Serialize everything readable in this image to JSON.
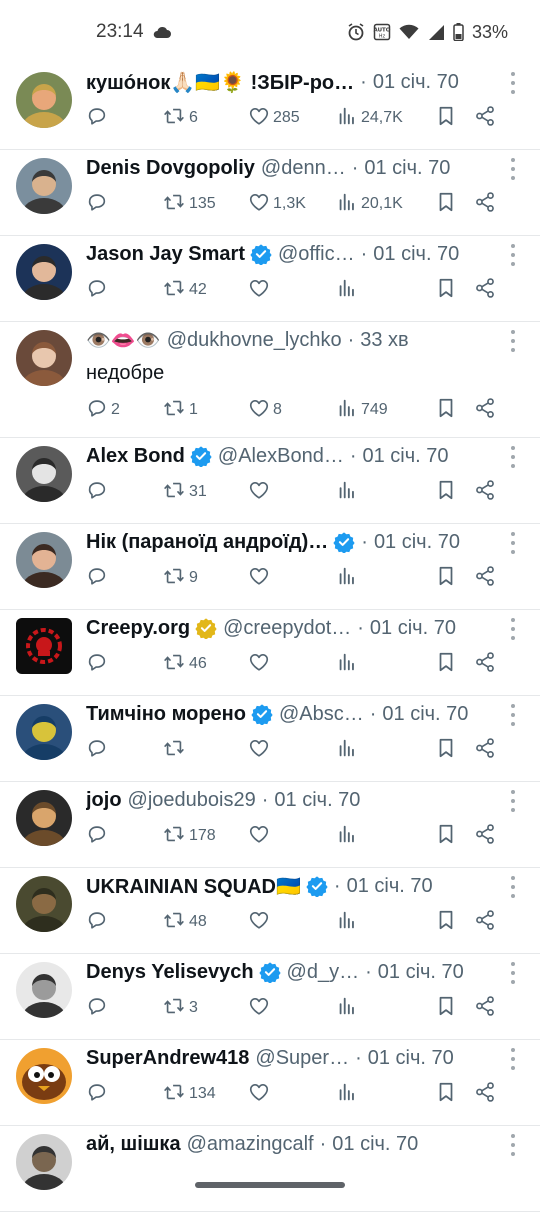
{
  "status_bar": {
    "time": "23:14",
    "battery": "33%",
    "icons": [
      "cloud-icon",
      "alarm-icon",
      "auto-brightness-icon",
      "wifi-icon",
      "signal-icon",
      "battery-icon"
    ]
  },
  "colors": {
    "verified_blue": "#1d9bf0",
    "verified_gold": "#e2b719",
    "secondary_text": "#536471"
  },
  "tweets": [
    {
      "name": "кушо́нок🙏🏻🇺🇦🌻 !ЗБІР-ро…",
      "handle": "",
      "time": "01 січ. 70",
      "text": "",
      "replies": "",
      "retweets": "6",
      "likes": "285",
      "views": "24,7K",
      "verified": ""
    },
    {
      "name": "Denis Dovgopoliy",
      "handle": "@denn…",
      "time": "01 січ. 70",
      "text": "",
      "replies": "",
      "retweets": "135",
      "likes": "1,3K",
      "views": "20,1K",
      "verified": ""
    },
    {
      "name": "Jason Jay Smart",
      "handle": "@offic…",
      "time": "01 січ. 70",
      "text": "",
      "replies": "",
      "retweets": "42",
      "likes": "",
      "views": "",
      "verified": "blue"
    },
    {
      "name": "👁️👄👁️",
      "handle": "@dukhovne_lychko",
      "time": "33 хв",
      "text": "недобре",
      "replies": "2",
      "retweets": "1",
      "likes": "8",
      "views": "749",
      "verified": ""
    },
    {
      "name": "Alex Bond",
      "handle": "@AlexBond…",
      "time": "01 січ. 70",
      "text": "",
      "replies": "",
      "retweets": "31",
      "likes": "",
      "views": "",
      "verified": "blue"
    },
    {
      "name": "Нік (параноїд андроїд)…",
      "handle": "",
      "time": "01 січ. 70",
      "text": "",
      "replies": "",
      "retweets": "9",
      "likes": "",
      "views": "",
      "verified": "blue"
    },
    {
      "name": "Creepy.org",
      "handle": "@creepydot…",
      "time": "01 січ. 70",
      "text": "",
      "replies": "",
      "retweets": "46",
      "likes": "",
      "views": "",
      "verified": "gold"
    },
    {
      "name": "Тимчіно морено",
      "handle": "@Absc…",
      "time": "01 січ. 70",
      "text": "",
      "replies": "",
      "retweets": "",
      "likes": "",
      "views": "",
      "verified": "blue"
    },
    {
      "name": "jojo",
      "handle": "@joedubois29",
      "time": "01 січ. 70",
      "text": "",
      "replies": "",
      "retweets": "178",
      "likes": "",
      "views": "",
      "verified": ""
    },
    {
      "name": "UKRAINIAN SQUAD🇺🇦",
      "handle": "",
      "time": "01 січ. 70",
      "text": "",
      "replies": "",
      "retweets": "48",
      "likes": "",
      "views": "",
      "verified": "blue"
    },
    {
      "name": "Denys Yelisevych",
      "handle": "@d_y…",
      "time": "01 січ. 70",
      "text": "",
      "replies": "",
      "retweets": "3",
      "likes": "",
      "views": "",
      "verified": "blue"
    },
    {
      "name": "SuperAndrew418",
      "handle": "@Super…",
      "time": "01 січ. 70",
      "text": "",
      "replies": "",
      "retweets": "134",
      "likes": "",
      "views": "",
      "verified": ""
    },
    {
      "name": "ай, шішка",
      "handle": "@amazingcalf",
      "time": "01 січ. 70",
      "text": "",
      "replies": "",
      "retweets": "",
      "likes": "",
      "views": "",
      "verified": ""
    }
  ]
}
